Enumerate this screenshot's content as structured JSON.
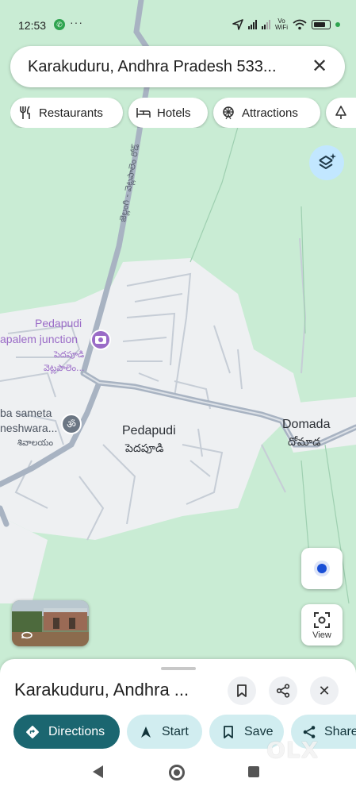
{
  "status_bar": {
    "time": "12:53",
    "icons": [
      "whatsapp-icon",
      "more-dots-icon",
      "location-arrow-icon",
      "signal-icon",
      "signal-icon",
      "vowifi-icon",
      "wifi-icon",
      "battery-icon"
    ],
    "vowifi_label": "Vo\nWiFi"
  },
  "search": {
    "query": "Karakuduru, Andhra Pradesh 533...",
    "close_icon": "close-icon"
  },
  "chips": [
    {
      "label": "Restaurants",
      "icon": "fork-knife-icon"
    },
    {
      "label": "Hotels",
      "icon": "bed-icon"
    },
    {
      "label": "Attractions",
      "icon": "ferris-wheel-icon"
    },
    {
      "label": "",
      "icon": "tree-icon"
    }
  ],
  "map": {
    "labels": {
      "pedapudi_poi_en": "Pedapudi",
      "pedapudi_poi_junction": "apalem junction",
      "pedapudi_poi_te1": "పెదపూడి",
      "pedapudi_poi_te2": "వెట్లపాలెం...",
      "road_label": "జెల్లంగి - వెట్లపాలెం రోడ్",
      "temple_en1": "ba sameta",
      "temple_en2": "neshwara...",
      "temple_te": "శివాలయం",
      "town_en": "Pedapudi",
      "town_te": "పెదపూడి",
      "village_en": "Domada",
      "village_te": "దోమాడ"
    },
    "colors": {
      "greenery": "#c9ecd4",
      "settlement": "#eef0f2",
      "road": "#a8b3c2",
      "poi_purple": "#9a6bc7"
    }
  },
  "controls": {
    "view_label": "View"
  },
  "sheet": {
    "title": "Karakuduru, Andhra ...",
    "actions": [
      {
        "label": "Directions",
        "icon": "directions-icon"
      },
      {
        "label": "Start",
        "icon": "navigation-arrow-icon"
      },
      {
        "label": "Save",
        "icon": "bookmark-icon"
      },
      {
        "label": "Share",
        "icon": "share-icon"
      }
    ]
  },
  "watermark": "OLX"
}
